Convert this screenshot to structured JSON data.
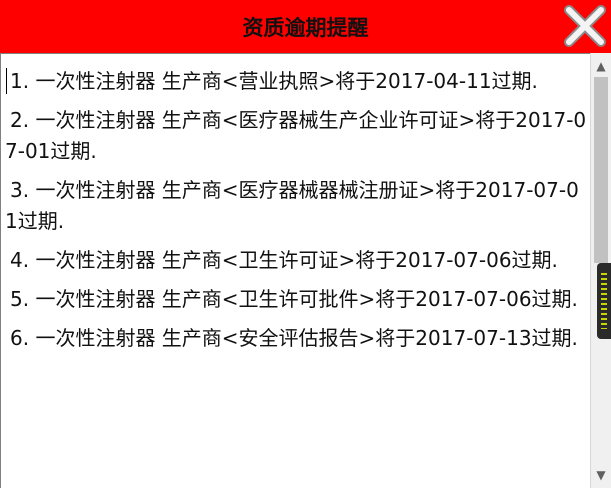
{
  "window": {
    "title": "资质逾期提醒",
    "accent_color": "#ff0000",
    "close_icon": "close-x-icon"
  },
  "items": [
    {
      "text": "1. 一次性注射器 生产商<营业执照>将于2017-04-11过期."
    },
    {
      "text": "2. 一次性注射器 生产商<医疗器械生产企业许可证>将于2017-07-01过期."
    },
    {
      "text": "3. 一次性注射器 生产商<医疗器械器械注册证>将于2017-07-01过期."
    },
    {
      "text": "4. 一次性注射器 生产商<卫生许可证>将于2017-07-06过期."
    },
    {
      "text": "5. 一次性注射器 生产商<卫生许可批件>将于2017-07-06过期."
    },
    {
      "text": "6. 一次性注射器 生产商<安全评估报告>将于2017-07-13过期."
    }
  ],
  "scrollbar": {
    "up_icon": "arrow-up-icon",
    "down_icon": "arrow-down-icon"
  }
}
